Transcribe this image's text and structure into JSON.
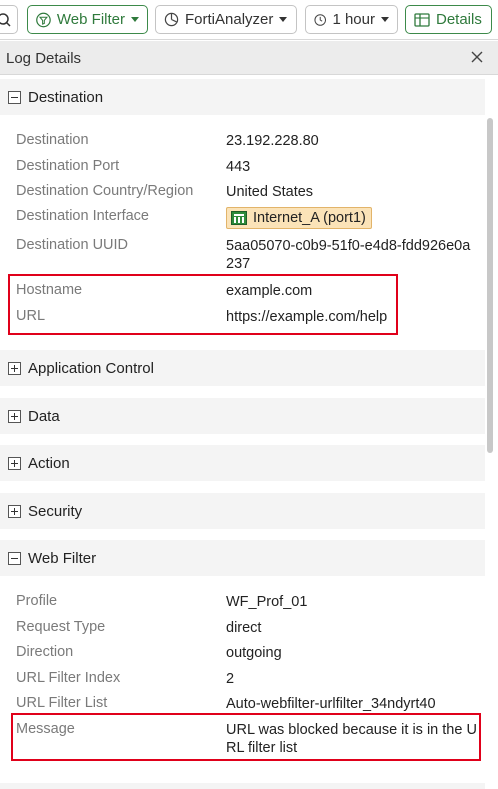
{
  "toolbar": {
    "webfilter_label": "Web Filter",
    "analyzer_label": "FortiAnalyzer",
    "hour_label": "1 hour",
    "details_label": "Details"
  },
  "panel": {
    "title": "Log Details"
  },
  "sections": {
    "destination": {
      "title": "Destination",
      "rows": [
        {
          "key": "Destination",
          "value": "23.192.228.80"
        },
        {
          "key": "Destination Port",
          "value": "443"
        },
        {
          "key": "Destination Country/Region",
          "value": "United States"
        },
        {
          "key": "Destination Interface",
          "value": "Internet_A (port1)"
        },
        {
          "key": "Destination UUID",
          "value": "5aa05070-c0b9-51f0-e4d8-fdd926e0a237"
        },
        {
          "key": "Hostname",
          "value": "example.com"
        },
        {
          "key": "URL",
          "value": "https://example.com/help"
        }
      ]
    },
    "application_control": {
      "title": "Application Control"
    },
    "data": {
      "title": "Data"
    },
    "action": {
      "title": "Action"
    },
    "security": {
      "title": "Security"
    },
    "web_filter": {
      "title": "Web Filter",
      "rows": [
        {
          "key": "Profile",
          "value": "WF_Prof_01"
        },
        {
          "key": "Request Type",
          "value": "direct"
        },
        {
          "key": "Direction",
          "value": "outgoing"
        },
        {
          "key": "URL Filter Index",
          "value": "2"
        },
        {
          "key": "URL Filter List",
          "value": "Auto-webfilter-urlfilter_34ndyrt40"
        },
        {
          "key": "Message",
          "value": "URL was blocked because it is in the URL filter list"
        }
      ]
    }
  },
  "colors": {
    "accent_green": "#2f7a3c",
    "highlight_red": "#e0001a",
    "badge_bg": "#fbe3b8"
  }
}
